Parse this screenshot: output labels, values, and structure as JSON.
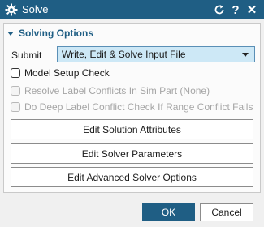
{
  "window": {
    "title": "Solve",
    "icon": "gear-icon",
    "controls": [
      "reset-icon",
      "help-icon",
      "close-icon"
    ],
    "help_label": "?",
    "close_label": "✕"
  },
  "section": {
    "title": "Solving Options"
  },
  "submit": {
    "label": "Submit",
    "value": "Write, Edit & Solve Input File"
  },
  "checks": [
    {
      "label": "Model Setup Check",
      "checked": false,
      "enabled": true
    },
    {
      "label": "Resolve Label Conflicts In Sim Part (None)",
      "checked": false,
      "enabled": false
    },
    {
      "label": "Do Deep Label Conflict Check If Range Conflict Fails",
      "checked": false,
      "enabled": false
    }
  ],
  "buttons": {
    "solution_attributes": "Edit Solution Attributes",
    "solver_parameters": "Edit Solver Parameters",
    "advanced_options": "Edit Advanced Solver Options"
  },
  "footer": {
    "ok": "OK",
    "cancel": "Cancel"
  },
  "colors": {
    "title_bar": "#1f5e84",
    "dropdown_bg": "#cde8f6",
    "section_text": "#1f5e84"
  }
}
